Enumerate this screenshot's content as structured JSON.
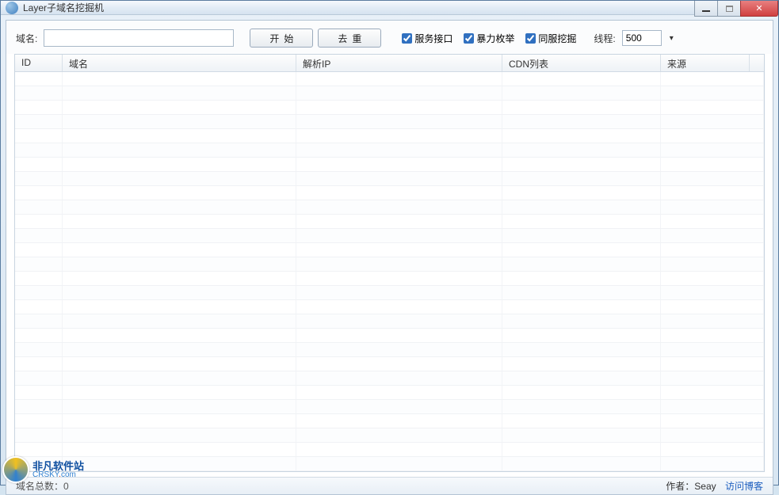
{
  "window": {
    "title": "Layer子域名挖掘机"
  },
  "toolbar": {
    "domain_label": "域名:",
    "domain_value": "",
    "start_label": "开始",
    "dedup_label": "去重",
    "chk_service_label": "服务接口",
    "chk_service_checked": true,
    "chk_brute_label": "暴力枚举",
    "chk_brute_checked": true,
    "chk_sameserver_label": "同服挖掘",
    "chk_sameserver_checked": true,
    "thread_label": "线程:",
    "thread_value": "500"
  },
  "table": {
    "headers": {
      "id": "ID",
      "domain": "域名",
      "ip": "解析IP",
      "cdn": "CDN列表",
      "source": "来源"
    },
    "rows": []
  },
  "statusbar": {
    "left_text": "域名总数：0",
    "author_label": "作者：",
    "author_name": "Seay",
    "blog_label": "访问博客"
  },
  "watermark": {
    "cn": "非凡软件站",
    "en_prefix": "CRSKY",
    "en_suffix": "com"
  }
}
